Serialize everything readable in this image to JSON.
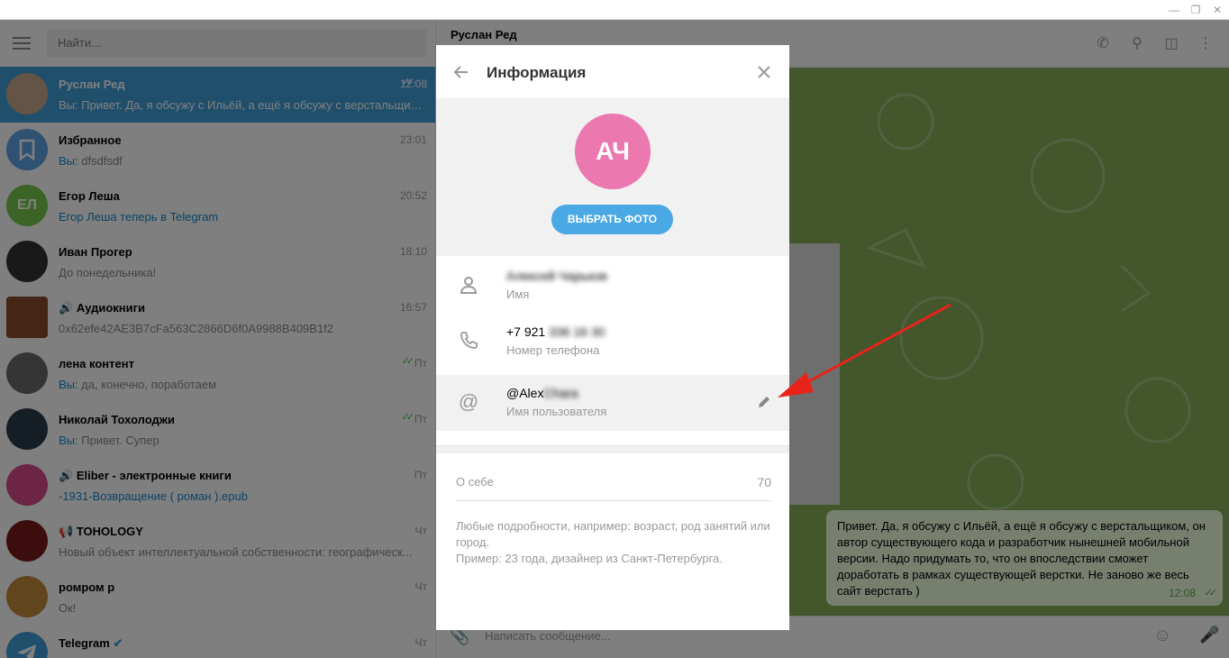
{
  "sidebar": {
    "search_placeholder": "Найти...",
    "chats": [
      {
        "name": "Руслан Ред",
        "time": "12:08",
        "prefix": "Вы: ",
        "message": "Привет. Да, я обсужу с Ильёй, а ещё я обсужу с верстальщиком...",
        "avatar_color": "#c9a98c"
      },
      {
        "name": "Избранное",
        "time": "23:01",
        "prefix": "Вы: ",
        "message": "dfsdfsdf",
        "avatar_color": "#5ea5e4"
      },
      {
        "name": "Егор Леша",
        "time": "20:52",
        "initials": "ЕЛ",
        "message": "Егор Леша теперь в Telegram",
        "avatar_color": "#76c84d"
      },
      {
        "name": "Иван Прогер",
        "time": "18:10",
        "message": "До понедельника!",
        "avatar_color": "#333333"
      },
      {
        "name": "Аудиокниги",
        "time": "16:57",
        "message": "0x62efe42AE3B7cFa563C2866D6f0A9988B409B1f2",
        "avatar_color": "#8a4a2a"
      },
      {
        "name": "лена контент",
        "time": "Пт",
        "prefix": "Вы: ",
        "message": "да, конечно, поработаем",
        "avatar_color": "#6a6a6a"
      },
      {
        "name": "Николай Тохолоджи",
        "time": "Пт",
        "prefix": "Вы: ",
        "message": "Привет. Супер",
        "avatar_color": "#2a3a4a"
      },
      {
        "name": "Eliber - электронные книги",
        "time": "Пт",
        "message": "-1931-Возвращение ( роман ).epub",
        "avatar_color": "#d94a8a"
      },
      {
        "name": "TOHOLOGY",
        "time": "Чт",
        "message": "Новый объект интеллектуальной собственности: географическ...",
        "avatar_color": "#7a1a1a"
      },
      {
        "name": "ромром р",
        "time": "Чт",
        "message": "Ок!",
        "avatar_color": "#c08a3a"
      },
      {
        "name": "Telegram",
        "time": "Чт",
        "message": "",
        "avatar_color": "#419fd9"
      }
    ]
  },
  "chat": {
    "title": "Руслан Ред",
    "bubble_text": "Привет. Да, я обсужу с Ильёй, а ещё я обсужу с верстальщиком, он автор существующего кода и разработчик нынешней мобильной версии. Надо придумать то, что он впоследствии сможет доработать в рамках существующей верстки. Не заново же весь сайт верстать )",
    "bubble_time": "12:08",
    "composer_placeholder": "Написать сообщение..."
  },
  "modal": {
    "title": "Информация",
    "initials": "АЧ",
    "photo_button": "ВЫБРАТЬ ФОТО",
    "name_value": "Алексей Чарьков",
    "name_label": "Имя",
    "phone_visible": "+7 921",
    "phone_hidden": "336 16 30",
    "phone_label": "Номер телефона",
    "username_visible": "@Alex",
    "username_hidden": "Chara",
    "username_label": "Имя пользователя",
    "about_label": "О себе",
    "about_count": "70",
    "about_hint": "Любые подробности, например: возраст, род занятий или город.\nПример: 23 года, дизайнер из Санкт-Петербурга."
  },
  "colors": {
    "accent": "#419fd9",
    "chat_bg": "#87ac58",
    "avatar_ach": "#ec78b0",
    "arrow": "#e8231a"
  }
}
